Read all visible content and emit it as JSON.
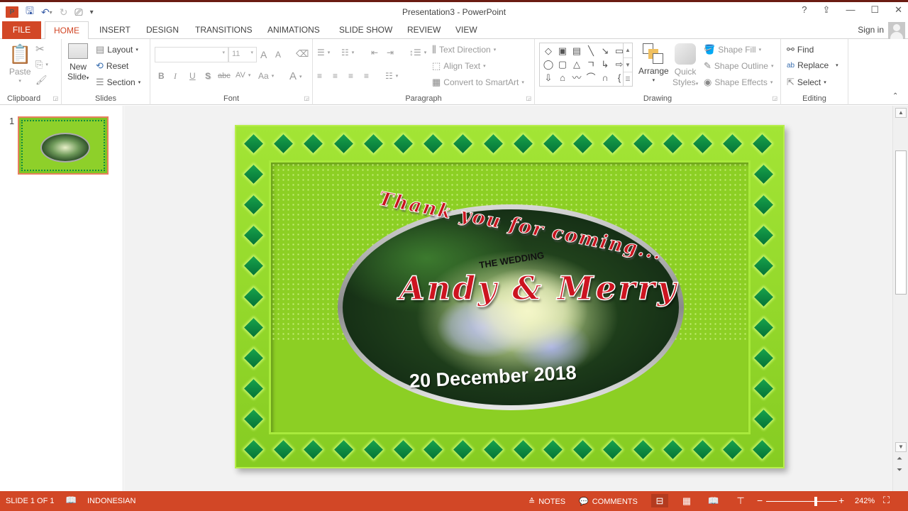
{
  "app": {
    "title": "Presentation3 - PowerPoint",
    "logo_label": "P",
    "quick_access": {
      "save_icon": "save-icon",
      "undo_icon": "undo-icon",
      "redo_icon": "redo-icon",
      "present_icon": "present-from-start-icon",
      "customize_icon": "customize-qat-icon"
    },
    "window_controls": {
      "help": "?",
      "ribbon_options": "⇪",
      "minimize": "—",
      "maximize": "☐",
      "close": "✕"
    },
    "sign_in": "Sign in"
  },
  "tabs": [
    {
      "label": "FILE"
    },
    {
      "label": "HOME",
      "active": true
    },
    {
      "label": "INSERT"
    },
    {
      "label": "DESIGN"
    },
    {
      "label": "TRANSITIONS"
    },
    {
      "label": "ANIMATIONS"
    },
    {
      "label": "SLIDE SHOW"
    },
    {
      "label": "REVIEW"
    },
    {
      "label": "VIEW"
    }
  ],
  "ribbon": {
    "clipboard": {
      "label": "Clipboard",
      "paste": "Paste"
    },
    "slides": {
      "label": "Slides",
      "new_slide_1": "New",
      "new_slide_2": "Slide",
      "layout": "Layout",
      "reset": "Reset",
      "section": "Section"
    },
    "font": {
      "label": "Font",
      "font_name": "",
      "font_size": "11",
      "bold": "B",
      "italic": "I",
      "underline": "U",
      "shadow": "S",
      "strike": "abc",
      "spacing": "AV",
      "case": "Aa",
      "color": "A",
      "grow": "A",
      "shrink": "A"
    },
    "paragraph": {
      "label": "Paragraph",
      "text_direction": "Text Direction",
      "align_text": "Align Text",
      "convert_smartart": "Convert to SmartArt"
    },
    "drawing": {
      "label": "Drawing",
      "arrange": "Arrange",
      "quick_styles_1": "Quick",
      "quick_styles_2": "Styles",
      "shape_fill": "Shape Fill",
      "shape_outline": "Shape Outline",
      "shape_effects": "Shape Effects",
      "shapes": [
        "◇",
        "▣",
        "▤",
        "╲",
        "↘",
        "▭",
        "◯",
        "▢",
        "△",
        "ㄱ",
        "↳",
        "⇨",
        "⇩",
        "⌂",
        "〰",
        "⌒",
        "∩",
        "{"
      ]
    },
    "editing": {
      "label": "Editing",
      "find": "Find",
      "replace": "Replace",
      "select": "Select"
    }
  },
  "thumbnails": [
    {
      "number": "1",
      "selected": true
    }
  ],
  "slide": {
    "thanks_text": "Thank you for coming...",
    "subtitle": "THE WEDDING",
    "names": "Andy & Merry",
    "date": "20 December 2018",
    "colors": {
      "background": "#8fd62a",
      "diamond": "#0b8a3f",
      "names": "#cc1420"
    }
  },
  "status": {
    "slide_info": "SLIDE 1 OF 1",
    "language": "INDONESIAN",
    "notes": "NOTES",
    "comments": "COMMENTS",
    "zoom_level": "242%",
    "zoom_fraction": 0.7
  },
  "colors": {
    "accent": "#d24726"
  }
}
